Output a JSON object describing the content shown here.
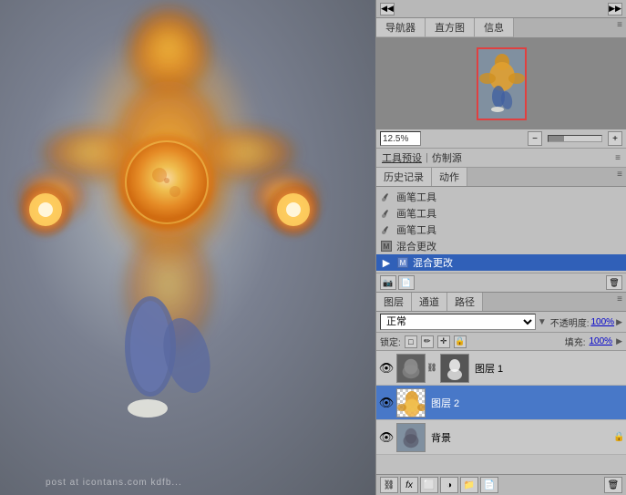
{
  "canvas": {
    "watermark": "post at icontans.com kdfb..."
  },
  "right_panel": {
    "nav_tabs": [
      "导航器",
      "直方图",
      "信息"
    ],
    "active_nav_tab": "导航器",
    "zoom_value": "12.5%",
    "tool_presets": {
      "label1": "工具预设",
      "label2": "仿制源"
    },
    "history_tabs": [
      "历史记录",
      "动作"
    ],
    "history_items": [
      {
        "icon": "brush",
        "label": "画笔工具"
      },
      {
        "icon": "brush",
        "label": "画笔工具"
      },
      {
        "icon": "brush",
        "label": "画笔工具"
      },
      {
        "icon": "merge",
        "label": "混合更改"
      },
      {
        "icon": "merge",
        "label": "混合更改",
        "selected": true
      }
    ],
    "layers_tabs": [
      "图层",
      "通道",
      "路径"
    ],
    "blend_mode": "正常",
    "opacity_label": "不透明度:",
    "opacity_value": "100%",
    "lock_label": "锁定:",
    "fill_label": "填充:",
    "fill_value": "100%",
    "layers": [
      {
        "name": "图层 1",
        "type": "normal",
        "visible": true,
        "selected": false
      },
      {
        "name": "图层 2",
        "type": "checkered",
        "visible": true,
        "selected": true
      },
      {
        "name": "背景",
        "type": "background",
        "visible": true,
        "selected": false,
        "locked": true
      }
    ],
    "bottom_buttons": [
      "link",
      "fx",
      "mask",
      "group",
      "new",
      "delete"
    ]
  }
}
